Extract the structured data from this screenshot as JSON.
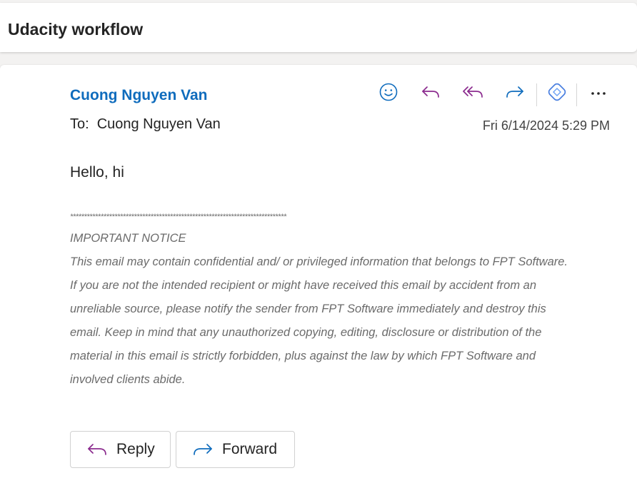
{
  "subject": {
    "title": "Udacity workflow"
  },
  "message": {
    "sender_name": "Cuong Nguyen Van",
    "to_label": "To:",
    "to_name": "Cuong Nguyen Van",
    "date": "Fri 6/14/2024 5:29 PM",
    "greeting": "Hello, hi",
    "notice": {
      "stars": "******************************************************************************",
      "heading": "IMPORTANT NOTICE",
      "lines": [
        "This email may contain confidential and/ or privileged information that belongs to FPT Software.",
        "If you are not the intended recipient or might have received this email by accident from an",
        "unreliable source, please notify the sender from FPT Software immediately and destroy this",
        "email. Keep in mind that any unauthorized copying, editing, disclosure or distribution of the",
        "material in this email is strictly forbidden, plus against the law by which FPT Software and",
        "involved clients abide."
      ]
    }
  },
  "toolbar": {
    "icons": [
      "smiley-icon",
      "reply-icon",
      "reply-all-icon",
      "forward-icon",
      "loop-icon",
      "more-icon"
    ]
  },
  "actions": {
    "reply_label": "Reply",
    "forward_label": "Forward"
  },
  "colors": {
    "sender": "#0f6cbd",
    "reply_icon": "#8b2b8e",
    "forward_icon": "#0f6cbd",
    "emoji_icon": "#0f6cbd"
  }
}
